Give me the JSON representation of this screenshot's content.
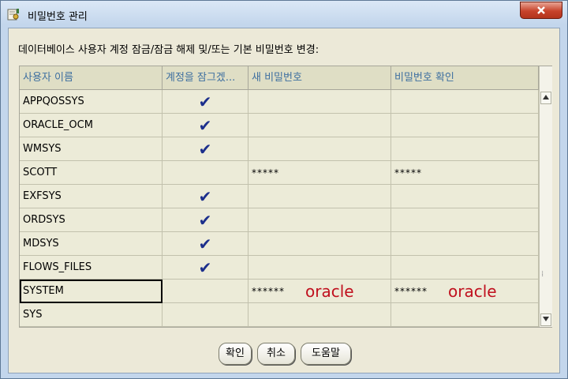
{
  "window": {
    "title": "비밀번호 관리",
    "icon": "key-app-icon",
    "close_icon": "close-icon"
  },
  "instruction": "데이터베이스 사용자 계정 잠금/잠금 해제 및/또는 기본 비밀번호 변경:",
  "table": {
    "columns": [
      "사용자 이름",
      "계정을 잠그겠...",
      "새 비밀번호",
      "비밀번호 확인"
    ],
    "rows": [
      {
        "user": "APPQOSSYS",
        "locked": "✔",
        "new_password": "",
        "confirm_password": ""
      },
      {
        "user": "ORACLE_OCM",
        "locked": "✔",
        "new_password": "",
        "confirm_password": ""
      },
      {
        "user": "WMSYS",
        "locked": "✔",
        "new_password": "",
        "confirm_password": ""
      },
      {
        "user": "SCOTT",
        "locked": "",
        "new_password": "*****",
        "confirm_password": "*****"
      },
      {
        "user": "EXFSYS",
        "locked": "✔",
        "new_password": "",
        "confirm_password": ""
      },
      {
        "user": "ORDSYS",
        "locked": "✔",
        "new_password": "",
        "confirm_password": ""
      },
      {
        "user": "MDSYS",
        "locked": "✔",
        "new_password": "",
        "confirm_password": ""
      },
      {
        "user": "FLOWS_FILES",
        "locked": "✔",
        "new_password": "",
        "confirm_password": ""
      },
      {
        "user": "SYSTEM",
        "locked": "",
        "new_password": "******",
        "confirm_password": "******",
        "new_annotation": "oracle",
        "confirm_annotation": "oracle"
      },
      {
        "user": "SYS",
        "locked": "",
        "new_password": "",
        "confirm_password": ""
      }
    ]
  },
  "buttons": {
    "ok": "확인",
    "cancel": "취소",
    "help": "도움말"
  },
  "colors": {
    "annotation": "#c0101e",
    "checkmark": "#1c2f8c",
    "header_text": "#3e6fa0"
  }
}
